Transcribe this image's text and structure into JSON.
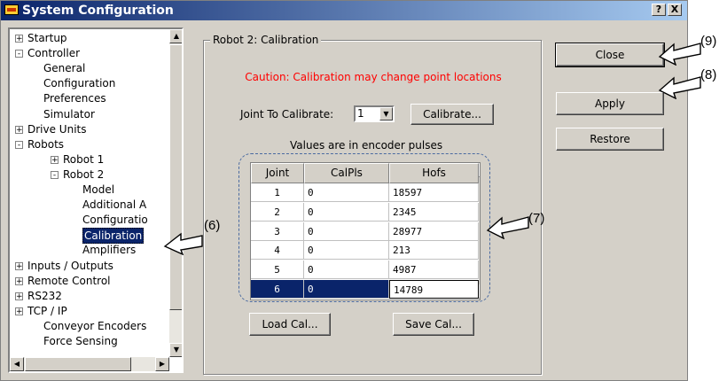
{
  "window": {
    "title": "System Configuration",
    "help_btn": "?",
    "close_btn": "X"
  },
  "tree": {
    "items": [
      {
        "label": "Startup",
        "exp": "+"
      },
      {
        "label": "Controller",
        "exp": "−"
      },
      {
        "label": "General"
      },
      {
        "label": "Configuration"
      },
      {
        "label": "Preferences"
      },
      {
        "label": "Simulator"
      },
      {
        "label": "Drive Units",
        "exp": "+"
      },
      {
        "label": "Robots",
        "exp": "−"
      },
      {
        "label": "Robot 1",
        "exp": "+"
      },
      {
        "label": "Robot 2",
        "exp": "−"
      },
      {
        "label": "Model"
      },
      {
        "label": "Additional A"
      },
      {
        "label": "Configuratio"
      },
      {
        "label": "Calibration",
        "selected": true
      },
      {
        "label": "Amplifiers"
      },
      {
        "label": "Inputs / Outputs",
        "exp": "+"
      },
      {
        "label": "Remote Control",
        "exp": "+"
      },
      {
        "label": "RS232",
        "exp": "+"
      },
      {
        "label": "TCP / IP",
        "exp": "+"
      },
      {
        "label": "Conveyor Encoders"
      },
      {
        "label": "Force Sensing"
      }
    ]
  },
  "panel": {
    "group_title": "Robot 2: Calibration",
    "caution": "Caution: Calibration may change point locations",
    "joint_label": "Joint To Calibrate:",
    "joint_value": "1",
    "calibrate_btn": "Calibrate...",
    "values_note": "Values are in encoder pulses",
    "grid": {
      "headers": [
        "Joint",
        "CalPls",
        "Hofs"
      ],
      "rows": [
        [
          "1",
          "0",
          "18597"
        ],
        [
          "2",
          "0",
          "2345"
        ],
        [
          "3",
          "0",
          "28977"
        ],
        [
          "4",
          "0",
          "213"
        ],
        [
          "5",
          "0",
          "4987"
        ],
        [
          "6",
          "0",
          "14789"
        ]
      ],
      "selected_row": 5
    },
    "load_btn": "Load Cal...",
    "save_btn": "Save Cal..."
  },
  "buttons": {
    "close": "Close",
    "apply": "Apply",
    "restore": "Restore"
  },
  "callouts": {
    "c6": "(6)",
    "c7": "(7)",
    "c8": "(8)",
    "c9": "(9)"
  },
  "colors": {
    "selection": "#0a246a",
    "caution": "#ff0000",
    "callout_outline": "#4a6aa0"
  }
}
